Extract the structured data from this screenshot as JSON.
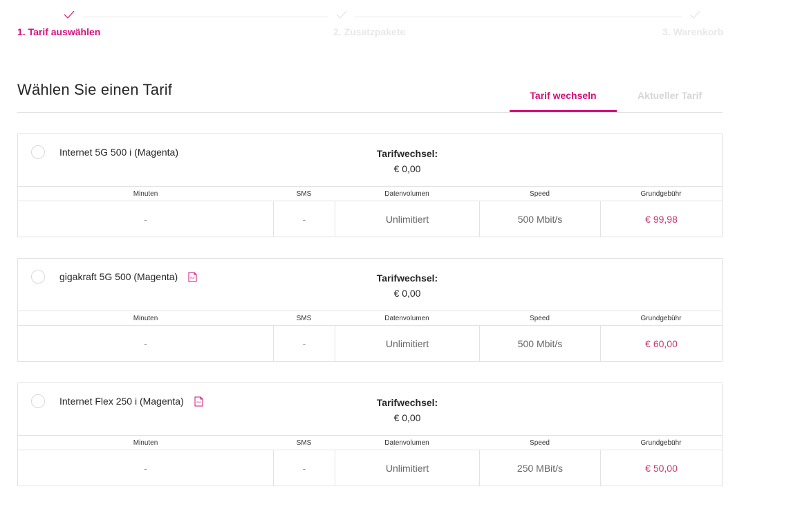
{
  "stepper": {
    "steps": [
      {
        "label": "1. Tarif auswählen",
        "state": "active"
      },
      {
        "label": "2. Zusatzpakete",
        "state": "inactive"
      },
      {
        "label": "3. Warenkorb",
        "state": "inactive"
      }
    ]
  },
  "page": {
    "title": "Wählen Sie einen Tarif"
  },
  "tabs": [
    {
      "label": "Tarif wechseln",
      "active": true
    },
    {
      "label": "Aktueller Tarif",
      "active": false
    }
  ],
  "columns": [
    "Minuten",
    "SMS",
    "Datenvolumen",
    "Speed",
    "Grundgebühr"
  ],
  "tariffs": [
    {
      "name": "Internet 5G 500 i (Magenta)",
      "has_pdf": false,
      "change_label": "Tarifwechsel:",
      "change_value": "€ 0,00",
      "minutes": "-",
      "sms": "-",
      "data": "Unlimitiert",
      "speed": "500 Mbit/s",
      "fee": "€ 99,98"
    },
    {
      "name": "gigakraft 5G 500 (Magenta)",
      "has_pdf": true,
      "pdf_icon": "pdf-document-icon",
      "change_label": "Tarifwechsel:",
      "change_value": "€ 0,00",
      "minutes": "-",
      "sms": "-",
      "data": "Unlimitiert",
      "speed": "500 Mbit/s",
      "fee": "€ 60,00"
    },
    {
      "name": "Internet Flex 250 i (Magenta)",
      "has_pdf": true,
      "pdf_icon": "pdf-document-icon",
      "change_label": "Tarifwechsel:",
      "change_value": "€ 0,00",
      "minutes": "-",
      "sms": "-",
      "data": "Unlimitiert",
      "speed": "250 MBit/s",
      "fee": "€ 50,00"
    }
  ],
  "colors": {
    "accent": "#d40f7d",
    "price": "#c4396f",
    "inactive_step": "#e8e8e8",
    "border": "#e2e2e2"
  }
}
